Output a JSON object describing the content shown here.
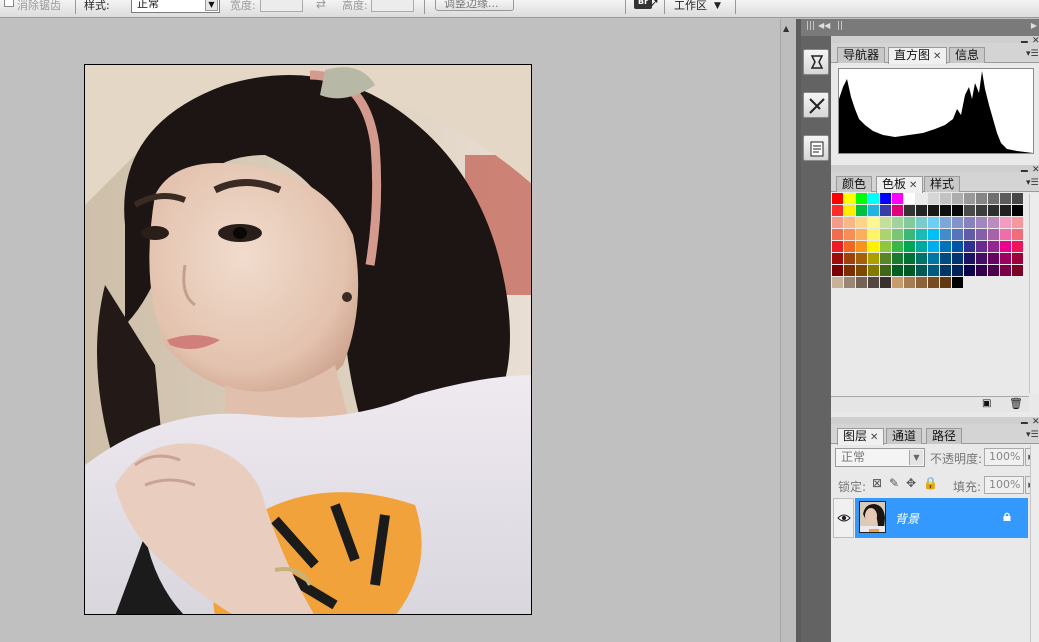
{
  "options_bar": {
    "clear_style_checkbox": "消除锯齿",
    "style_label": "样式:",
    "style_value": "正常",
    "width_label": "宽度:",
    "height_label": "高度:",
    "refine_edge_button": "调整边缘...",
    "bridge_icon": "Br",
    "workspace_label": "工作区"
  },
  "navigator_group": {
    "tabs": [
      {
        "label": "导航器",
        "active": false,
        "closable": false
      },
      {
        "label": "直方图",
        "active": true,
        "closable": true
      },
      {
        "label": "信息",
        "active": false,
        "closable": false
      }
    ]
  },
  "swatch_group": {
    "tabs": [
      {
        "label": "颜色",
        "active": false,
        "closable": false
      },
      {
        "label": "色板",
        "active": true,
        "closable": true
      },
      {
        "label": "样式",
        "active": false,
        "closable": false
      }
    ],
    "rows": [
      [
        "#ff0000",
        "#ffff00",
        "#00ff00",
        "#00ffff",
        "#0000ff",
        "#ff00ff",
        "#ffffff",
        "#ebebeb",
        "#d6d6d6",
        "#c2c2c2",
        "#adadad",
        "#999999",
        "#858585",
        "#707070",
        "#5c5c5c",
        "#474747"
      ],
      [
        "#ff2a2a",
        "#ffee00",
        "#00c040",
        "#22b4e0",
        "#3a3aaa",
        "#e0007a",
        "#333333",
        "#242424",
        "#181818",
        "#0e0e0e",
        "#070707",
        "#4a4a4a",
        "#3c3c3c",
        "#2e2e2e",
        "#202020",
        "#000000"
      ],
      [
        "#f49a86",
        "#f8b786",
        "#fcd48a",
        "#fff793",
        "#c4df9b",
        "#a3d39c",
        "#82ca9c",
        "#7acccb",
        "#6dcff6",
        "#7da7d9",
        "#8393ca",
        "#8781bd",
        "#a187be",
        "#bc8cbf",
        "#f49bc1",
        "#f5989d"
      ],
      [
        "#f26c4f",
        "#f68e55",
        "#fbaf5c",
        "#fff467",
        "#acd372",
        "#7cc576",
        "#3bb878",
        "#1abbb4",
        "#00bff3",
        "#438ccb",
        "#5574b9",
        "#605ca8",
        "#855fa8",
        "#a763a9",
        "#ef6ea8",
        "#f16d7e"
      ],
      [
        "#ed1c24",
        "#f26522",
        "#f7941d",
        "#fff200",
        "#8dc63f",
        "#39b54a",
        "#00a651",
        "#00a99d",
        "#00aeef",
        "#0072bc",
        "#0054a5",
        "#2e3192",
        "#662d91",
        "#92278f",
        "#ec008c",
        "#ed145b"
      ],
      [
        "#9e0b0f",
        "#a0410d",
        "#a36209",
        "#aba000",
        "#598527",
        "#1a7b30",
        "#007236",
        "#00746b",
        "#0076a4",
        "#004a80",
        "#003471",
        "#1b1464",
        "#440e62",
        "#630460",
        "#9e005d",
        "#9e0039"
      ],
      [
        "#790000",
        "#7b2e00",
        "#7d4900",
        "#827b00",
        "#406618",
        "#005e20",
        "#005826",
        "#005952",
        "#005b7f",
        "#003663",
        "#002157",
        "#0d004c",
        "#32004b",
        "#4b0049",
        "#7b0046",
        "#7a0026"
      ],
      [
        "#c7b299",
        "#998675",
        "#736357",
        "#534741",
        "#37302d",
        "#c69c6d",
        "#a67c52",
        "#8c6239",
        "#754c24",
        "#603913",
        "#000000"
      ]
    ]
  },
  "layers_group": {
    "tabs": [
      {
        "label": "图层",
        "active": true,
        "closable": true
      },
      {
        "label": "通道",
        "active": false,
        "closable": false
      },
      {
        "label": "路径",
        "active": false,
        "closable": false
      }
    ],
    "blend_mode": "正常",
    "opacity_label": "不透明度:",
    "opacity_value": "100%",
    "lock_label": "锁定:",
    "fill_label": "填充:",
    "fill_value": "100%",
    "layers": [
      {
        "name": "背景",
        "visible": true,
        "locked": true,
        "selected": true
      }
    ]
  },
  "colors": {
    "selection": "#3399ff",
    "canvas_bg": "#c0c0c0",
    "dock": "#636363"
  }
}
